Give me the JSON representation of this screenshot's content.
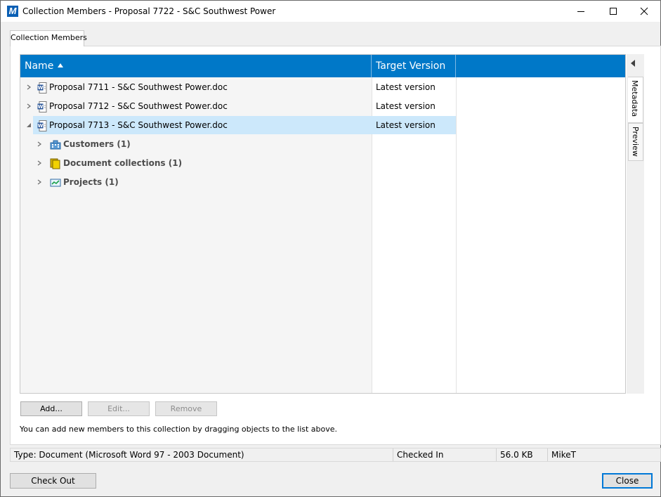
{
  "window": {
    "title": "Collection Members - Proposal 7722 - S&C Southwest Power",
    "app_icon_letter": "M"
  },
  "tab": {
    "label": "Collection Members"
  },
  "list": {
    "columns": [
      "Name",
      "Target Version"
    ],
    "sort_column": "Name",
    "sort_direction": "ascending",
    "rows": [
      {
        "name": "Proposal 7711 - S&C Southwest Power.doc",
        "target": "Latest version",
        "expanded": false,
        "selected": false
      },
      {
        "name": "Proposal 7712 - S&C Southwest Power.doc",
        "target": "Latest version",
        "expanded": false,
        "selected": false
      },
      {
        "name": "Proposal 7713 - S&C Southwest Power.doc",
        "target": "Latest version",
        "expanded": true,
        "selected": true
      }
    ],
    "children": [
      {
        "label": "Customers (1)",
        "icon": "customers-icon"
      },
      {
        "label": "Document collections (1)",
        "icon": "document-collections-icon"
      },
      {
        "label": "Projects (1)",
        "icon": "projects-icon"
      }
    ]
  },
  "side_tabs": {
    "metadata": "Metadata",
    "preview": "Preview"
  },
  "buttons": {
    "add": "Add...",
    "edit": "Edit...",
    "remove": "Remove",
    "check_out": "Check Out",
    "close": "Close"
  },
  "hint": "You can add new members to this collection by dragging objects to the list above.",
  "status": {
    "type": "Type: Document (Microsoft Word 97 - 2003 Document)",
    "state": "Checked In",
    "size": "56.0 KB",
    "user": "MikeT"
  },
  "colors": {
    "header_blue": "#0078c8",
    "selection": "#cce8fb",
    "word_icon": "#2b579a"
  }
}
